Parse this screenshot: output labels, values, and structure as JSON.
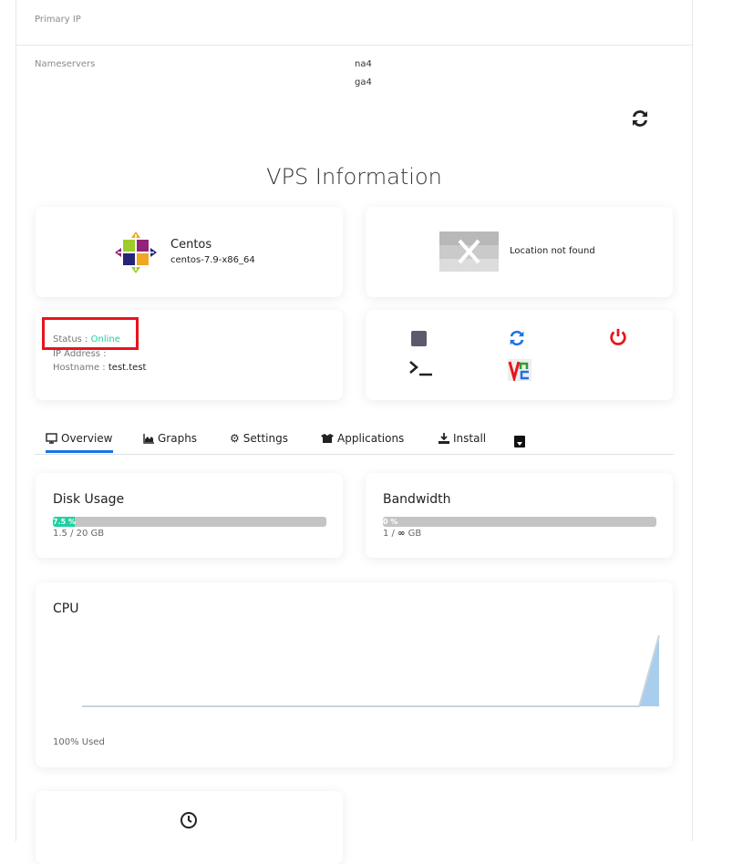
{
  "info": {
    "primary_ip_label": "Primary IP",
    "nameservers_label": "Nameservers",
    "nameservers": [
      "na4",
      "ga4"
    ]
  },
  "page_title": "VPS Information",
  "os": {
    "name": "Centos",
    "template": "centos-7.9-x86_64"
  },
  "location": {
    "text": "Location not found"
  },
  "status": {
    "status_label": "Status :",
    "status_value": "Online",
    "status_color": "#1dd1a1",
    "ip_label": "IP Address :",
    "ip_value": "",
    "hostname_label": "Hostname :",
    "hostname_value": "test.test"
  },
  "actions": [
    "stop-icon",
    "restart-icon",
    "power-icon",
    "terminal-icon",
    "vnc-icon"
  ],
  "tabs": [
    {
      "label": "Overview",
      "icon": "monitor-icon",
      "active": true
    },
    {
      "label": "Graphs",
      "icon": "chart-area-icon"
    },
    {
      "label": "Settings",
      "icon": "gear-icon"
    },
    {
      "label": "Applications",
      "icon": "box-icon"
    },
    {
      "label": "Install",
      "icon": "download-icon"
    }
  ],
  "disk": {
    "title": "Disk Usage",
    "percent": 7.5,
    "percent_label": "7.5 %",
    "usage": "1.5 / 20 GB"
  },
  "bandwidth": {
    "title": "Bandwidth",
    "percent": 0,
    "percent_label": "0 %",
    "used": "1 /",
    "unit": "GB"
  },
  "cpu": {
    "title": "CPU",
    "footer": "100% Used",
    "values": [
      0,
      0,
      0,
      0,
      0,
      0,
      0,
      0,
      0,
      0,
      0,
      0,
      0,
      0,
      0,
      0,
      0,
      0,
      0,
      0,
      0,
      0,
      0,
      0,
      0,
      0,
      0,
      0,
      0,
      100
    ]
  },
  "accent": "#1a73e8"
}
